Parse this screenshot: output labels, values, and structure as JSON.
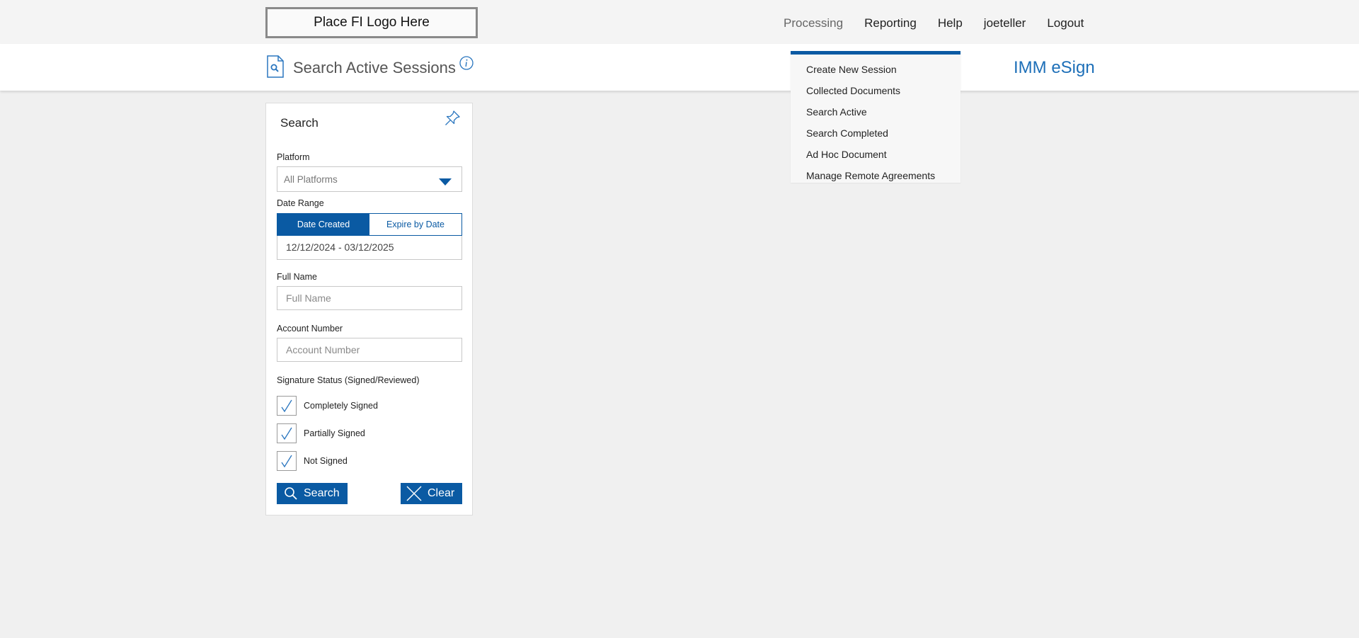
{
  "header": {
    "logo_text": "Place FI Logo Here",
    "nav": [
      {
        "label": "Processing"
      },
      {
        "label": "Reporting"
      },
      {
        "label": "Help"
      },
      {
        "label": "joeteller"
      },
      {
        "label": "Logout"
      }
    ]
  },
  "subheader": {
    "title": "Search Active Sessions",
    "brand": "IMM eSign"
  },
  "processing_menu": {
    "items": [
      {
        "label": "Create New Session"
      },
      {
        "label": "Collected Documents"
      },
      {
        "label": "Search Active"
      },
      {
        "label": "Search Completed"
      },
      {
        "label": "Ad Hoc Document"
      },
      {
        "label": "Manage Remote Agreements"
      }
    ]
  },
  "search_panel": {
    "title": "Search",
    "platform": {
      "label": "Platform",
      "value": "All Platforms"
    },
    "date_range": {
      "label": "Date Range",
      "options": [
        {
          "label": "Date Created",
          "selected": true
        },
        {
          "label": "Expire by Date",
          "selected": false
        }
      ],
      "value": "12/12/2024 - 03/12/2025"
    },
    "full_name": {
      "label": "Full Name",
      "placeholder": "Full Name"
    },
    "account_number": {
      "label": "Account Number",
      "placeholder": "Account Number"
    },
    "signature_status": {
      "label": "Signature Status (Signed/Reviewed)",
      "options": [
        {
          "label": "Completely Signed",
          "checked": true
        },
        {
          "label": "Partially Signed",
          "checked": true
        },
        {
          "label": "Not Signed",
          "checked": true
        }
      ]
    },
    "search_button": "Search",
    "clear_button": "Clear"
  },
  "colors": {
    "accent": "#0a5aa3",
    "brand": "#1d6fb8",
    "background": "#f0f0f0"
  },
  "icons": [
    "search-document-icon",
    "info-icon",
    "pin-icon",
    "caret-down-icon",
    "checkmark-icon",
    "magnifier-icon",
    "close-x-icon"
  ]
}
